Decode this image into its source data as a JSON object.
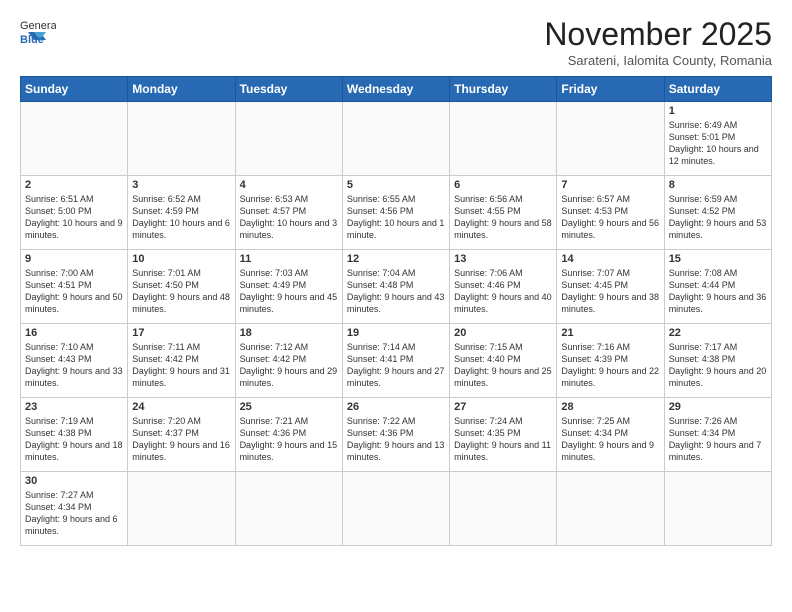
{
  "header": {
    "logo_general": "General",
    "logo_blue": "Blue",
    "month_title": "November 2025",
    "subtitle": "Sarateni, Ialomita County, Romania"
  },
  "days_of_week": [
    "Sunday",
    "Monday",
    "Tuesday",
    "Wednesday",
    "Thursday",
    "Friday",
    "Saturday"
  ],
  "weeks": [
    [
      {
        "day": "",
        "info": ""
      },
      {
        "day": "",
        "info": ""
      },
      {
        "day": "",
        "info": ""
      },
      {
        "day": "",
        "info": ""
      },
      {
        "day": "",
        "info": ""
      },
      {
        "day": "",
        "info": ""
      },
      {
        "day": "1",
        "info": "Sunrise: 6:49 AM\nSunset: 5:01 PM\nDaylight: 10 hours and 12 minutes."
      }
    ],
    [
      {
        "day": "2",
        "info": "Sunrise: 6:51 AM\nSunset: 5:00 PM\nDaylight: 10 hours and 9 minutes."
      },
      {
        "day": "3",
        "info": "Sunrise: 6:52 AM\nSunset: 4:59 PM\nDaylight: 10 hours and 6 minutes."
      },
      {
        "day": "4",
        "info": "Sunrise: 6:53 AM\nSunset: 4:57 PM\nDaylight: 10 hours and 3 minutes."
      },
      {
        "day": "5",
        "info": "Sunrise: 6:55 AM\nSunset: 4:56 PM\nDaylight: 10 hours and 1 minute."
      },
      {
        "day": "6",
        "info": "Sunrise: 6:56 AM\nSunset: 4:55 PM\nDaylight: 9 hours and 58 minutes."
      },
      {
        "day": "7",
        "info": "Sunrise: 6:57 AM\nSunset: 4:53 PM\nDaylight: 9 hours and 56 minutes."
      },
      {
        "day": "8",
        "info": "Sunrise: 6:59 AM\nSunset: 4:52 PM\nDaylight: 9 hours and 53 minutes."
      }
    ],
    [
      {
        "day": "9",
        "info": "Sunrise: 7:00 AM\nSunset: 4:51 PM\nDaylight: 9 hours and 50 minutes."
      },
      {
        "day": "10",
        "info": "Sunrise: 7:01 AM\nSunset: 4:50 PM\nDaylight: 9 hours and 48 minutes."
      },
      {
        "day": "11",
        "info": "Sunrise: 7:03 AM\nSunset: 4:49 PM\nDaylight: 9 hours and 45 minutes."
      },
      {
        "day": "12",
        "info": "Sunrise: 7:04 AM\nSunset: 4:48 PM\nDaylight: 9 hours and 43 minutes."
      },
      {
        "day": "13",
        "info": "Sunrise: 7:06 AM\nSunset: 4:46 PM\nDaylight: 9 hours and 40 minutes."
      },
      {
        "day": "14",
        "info": "Sunrise: 7:07 AM\nSunset: 4:45 PM\nDaylight: 9 hours and 38 minutes."
      },
      {
        "day": "15",
        "info": "Sunrise: 7:08 AM\nSunset: 4:44 PM\nDaylight: 9 hours and 36 minutes."
      }
    ],
    [
      {
        "day": "16",
        "info": "Sunrise: 7:10 AM\nSunset: 4:43 PM\nDaylight: 9 hours and 33 minutes."
      },
      {
        "day": "17",
        "info": "Sunrise: 7:11 AM\nSunset: 4:42 PM\nDaylight: 9 hours and 31 minutes."
      },
      {
        "day": "18",
        "info": "Sunrise: 7:12 AM\nSunset: 4:42 PM\nDaylight: 9 hours and 29 minutes."
      },
      {
        "day": "19",
        "info": "Sunrise: 7:14 AM\nSunset: 4:41 PM\nDaylight: 9 hours and 27 minutes."
      },
      {
        "day": "20",
        "info": "Sunrise: 7:15 AM\nSunset: 4:40 PM\nDaylight: 9 hours and 25 minutes."
      },
      {
        "day": "21",
        "info": "Sunrise: 7:16 AM\nSunset: 4:39 PM\nDaylight: 9 hours and 22 minutes."
      },
      {
        "day": "22",
        "info": "Sunrise: 7:17 AM\nSunset: 4:38 PM\nDaylight: 9 hours and 20 minutes."
      }
    ],
    [
      {
        "day": "23",
        "info": "Sunrise: 7:19 AM\nSunset: 4:38 PM\nDaylight: 9 hours and 18 minutes."
      },
      {
        "day": "24",
        "info": "Sunrise: 7:20 AM\nSunset: 4:37 PM\nDaylight: 9 hours and 16 minutes."
      },
      {
        "day": "25",
        "info": "Sunrise: 7:21 AM\nSunset: 4:36 PM\nDaylight: 9 hours and 15 minutes."
      },
      {
        "day": "26",
        "info": "Sunrise: 7:22 AM\nSunset: 4:36 PM\nDaylight: 9 hours and 13 minutes."
      },
      {
        "day": "27",
        "info": "Sunrise: 7:24 AM\nSunset: 4:35 PM\nDaylight: 9 hours and 11 minutes."
      },
      {
        "day": "28",
        "info": "Sunrise: 7:25 AM\nSunset: 4:34 PM\nDaylight: 9 hours and 9 minutes."
      },
      {
        "day": "29",
        "info": "Sunrise: 7:26 AM\nSunset: 4:34 PM\nDaylight: 9 hours and 7 minutes."
      }
    ],
    [
      {
        "day": "30",
        "info": "Sunrise: 7:27 AM\nSunset: 4:34 PM\nDaylight: 9 hours and 6 minutes."
      },
      {
        "day": "",
        "info": ""
      },
      {
        "day": "",
        "info": ""
      },
      {
        "day": "",
        "info": ""
      },
      {
        "day": "",
        "info": ""
      },
      {
        "day": "",
        "info": ""
      },
      {
        "day": "",
        "info": ""
      }
    ]
  ]
}
